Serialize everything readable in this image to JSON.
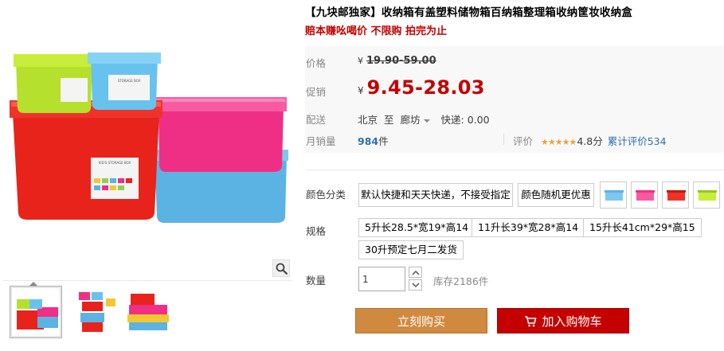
{
  "product": {
    "title": "【九块邮独家】收纳箱有盖塑料储物箱百纳箱整理箱收纳筐妆收纳盒",
    "subtitle": "赔本赚吆喝价 不限购 拍完为止"
  },
  "gallery": {
    "box_label_large": "KID'S STORAGE BOX",
    "box_label_small": "STORAGE BOX",
    "thumbnails": [
      "thumbnail-1",
      "thumbnail-2",
      "thumbnail-3"
    ]
  },
  "price": {
    "label": "价格",
    "currency": "¥",
    "original": "19.90-59.00"
  },
  "promo": {
    "label": "促销",
    "currency": "¥",
    "price": "9.45-28.03"
  },
  "delivery": {
    "label": "配送",
    "from": "北京",
    "to_word": "至",
    "to": "廊坊",
    "shipping": "快递: 0.00"
  },
  "sales": {
    "label": "月销量",
    "count": "984",
    "unit": "件"
  },
  "rating": {
    "label": "评价",
    "stars": "★★★★★",
    "score": "4.8分",
    "count_text": "累计评价534"
  },
  "color_option": {
    "label": "颜色分类",
    "options": [
      "默认快捷和天天快递，不接受指定",
      "颜色随机更优惠"
    ],
    "swatches": [
      "blue-box",
      "pink-box",
      "red-box",
      "green-box"
    ]
  },
  "spec": {
    "label": "规格",
    "options": [
      "5升长28.5*宽19*高14",
      "11升长39*宽28*高14",
      "15升长41cm*29*高15",
      "30升预定七月二发货"
    ]
  },
  "quantity": {
    "label": "数量",
    "value": "1",
    "stock": "库存2186件"
  },
  "actions": {
    "buy_now": "立刻购买",
    "add_to_cart": "加入购物车"
  },
  "colors": {
    "accent_red": "#c40000",
    "buy_orange": "#d08a40",
    "link_blue": "#2f6fae",
    "star_orange": "#e8a33a"
  }
}
